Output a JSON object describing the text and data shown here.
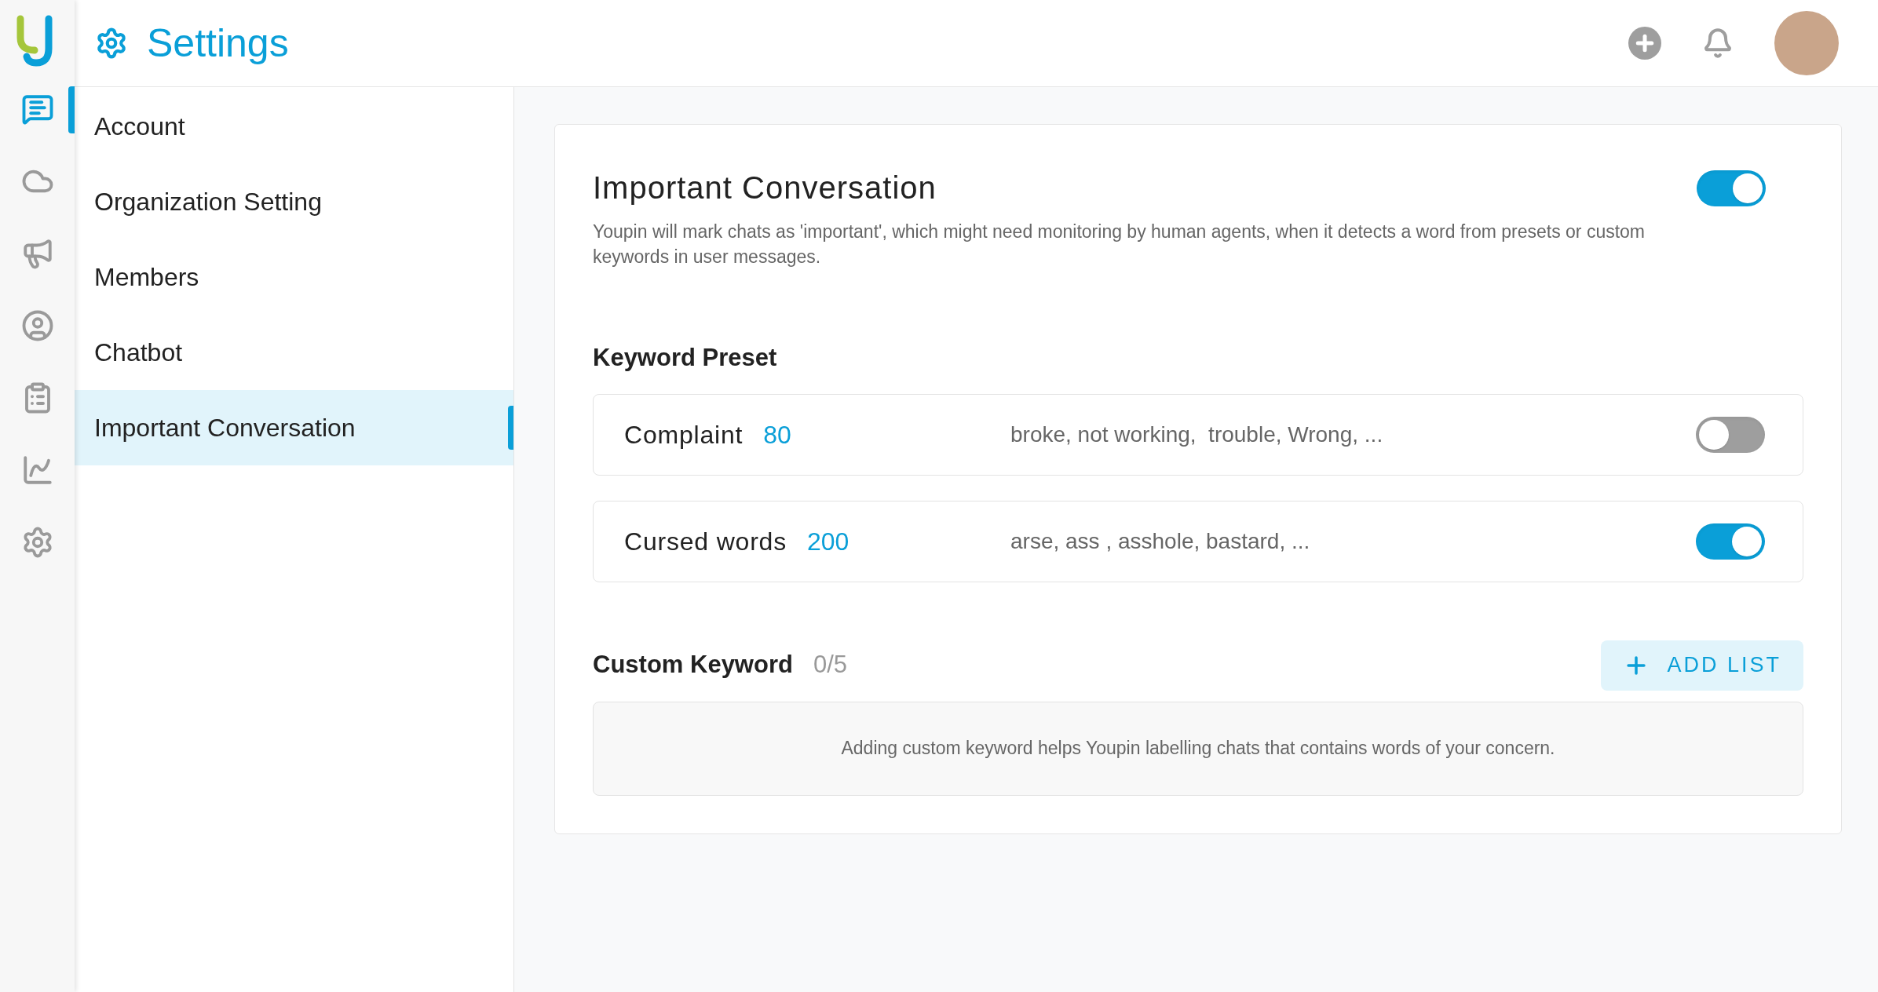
{
  "header": {
    "title": "Settings"
  },
  "rail": [
    {
      "kind": "chat",
      "selected": true
    },
    {
      "kind": "cloud",
      "selected": false
    },
    {
      "kind": "megaphone",
      "selected": false
    },
    {
      "kind": "user",
      "selected": false
    },
    {
      "kind": "list",
      "selected": false
    },
    {
      "kind": "chart",
      "selected": false
    },
    {
      "kind": "gear",
      "selected": false
    }
  ],
  "menu": [
    {
      "label": "Account",
      "selected": false
    },
    {
      "label": "Organization Setting",
      "selected": false
    },
    {
      "label": "Members",
      "selected": false
    },
    {
      "label": "Chatbot",
      "selected": false
    },
    {
      "label": "Important Conversation",
      "selected": true
    }
  ],
  "card": {
    "title": "Important Conversation",
    "on": true,
    "description": "Youpin will mark chats as 'important', which might need monitoring by human agents, when it detects a word from presets or custom keywords in user messages."
  },
  "keyword_preset": {
    "title": "Keyword Preset",
    "rows": [
      {
        "name": "Complaint",
        "count": "80",
        "words": "broke, not working,  trouble, Wrong, ...",
        "on": false
      },
      {
        "name": "Cursed words",
        "count": "200",
        "words": "arse, ass , asshole, bastard, ...",
        "on": true
      }
    ]
  },
  "custom_keyword": {
    "title": "Custom Keyword",
    "count": "0/5",
    "button": "ADD LIST",
    "empty_text": "Adding custom keyword helps Youpin labelling chats that contains words of your concern."
  }
}
